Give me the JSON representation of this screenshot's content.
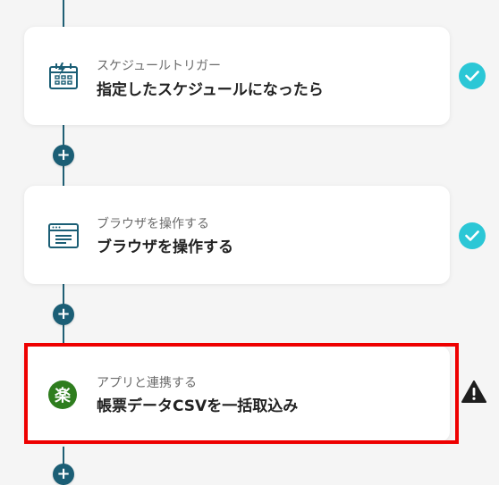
{
  "steps": [
    {
      "subtitle": "スケジュールトリガー",
      "title": "指定したスケジュールになったら",
      "icon": "schedule-calendar-icon",
      "status": "complete"
    },
    {
      "subtitle": "ブラウザを操作する",
      "title": "ブラウザを操作する",
      "icon": "browser-window-icon",
      "status": "complete"
    },
    {
      "subtitle": "アプリと連携する",
      "title": "帳票データCSVを一括取込み",
      "icon": "rakuten-raku-icon",
      "status": "warning",
      "icon_glyph": "楽"
    }
  ],
  "add_step_label": "+",
  "colors": {
    "accent": "#1b5e75",
    "check": "#2bc7d6",
    "highlight": "#ee0000"
  }
}
